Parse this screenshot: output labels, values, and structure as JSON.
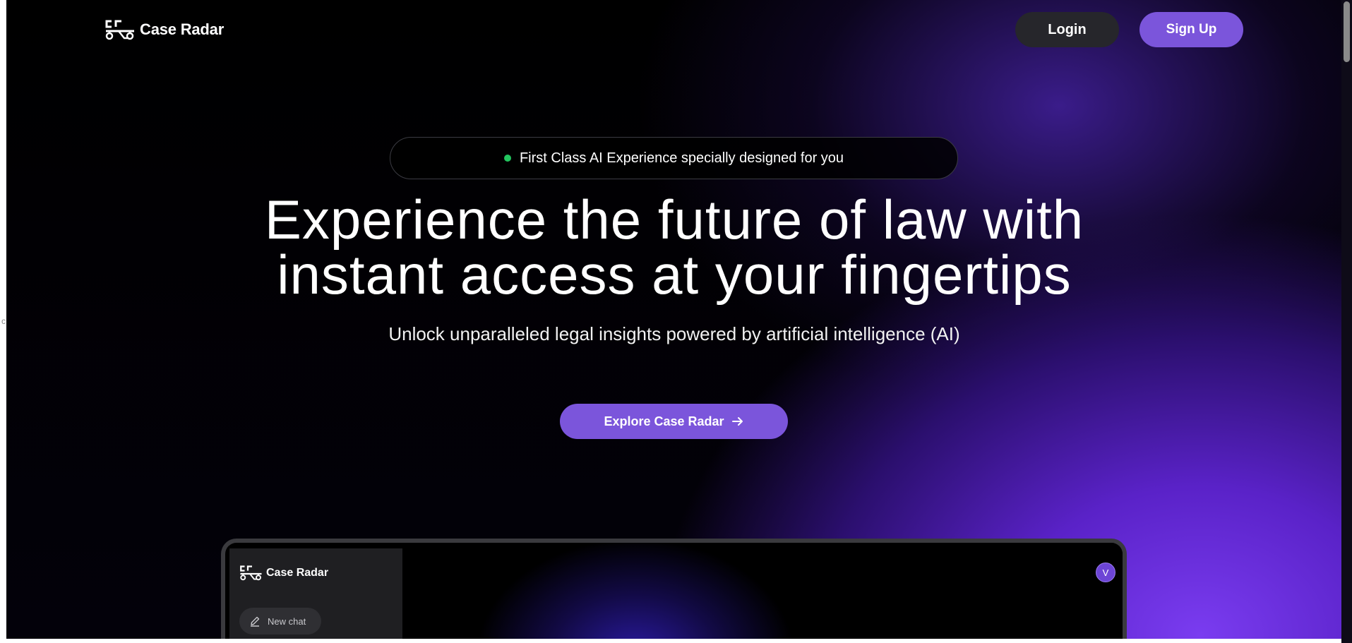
{
  "header": {
    "brand": "Case Radar",
    "login_label": "Login",
    "signup_label": "Sign Up"
  },
  "hero": {
    "badge_text": "First Class AI Experience specially designed for you",
    "headline_line1": "Experience the future of law with",
    "headline_line2": "instant access at your fingertips",
    "subheadline": "Unlock unparalleled legal insights powered by artificial intelligence (AI)",
    "cta_label": "Explore Case Radar"
  },
  "preview": {
    "brand": "Case Radar",
    "new_chat_label": "New chat",
    "avatar_initial": "V"
  },
  "edge_glyph": "c",
  "colors": {
    "accent": "#7b55db",
    "login_bg": "#26262b",
    "status_dot": "#22c55e"
  },
  "icons": {
    "logo": "case-radar-logo-icon",
    "cta": "arrow-right-icon",
    "new_chat": "pencil-icon"
  }
}
